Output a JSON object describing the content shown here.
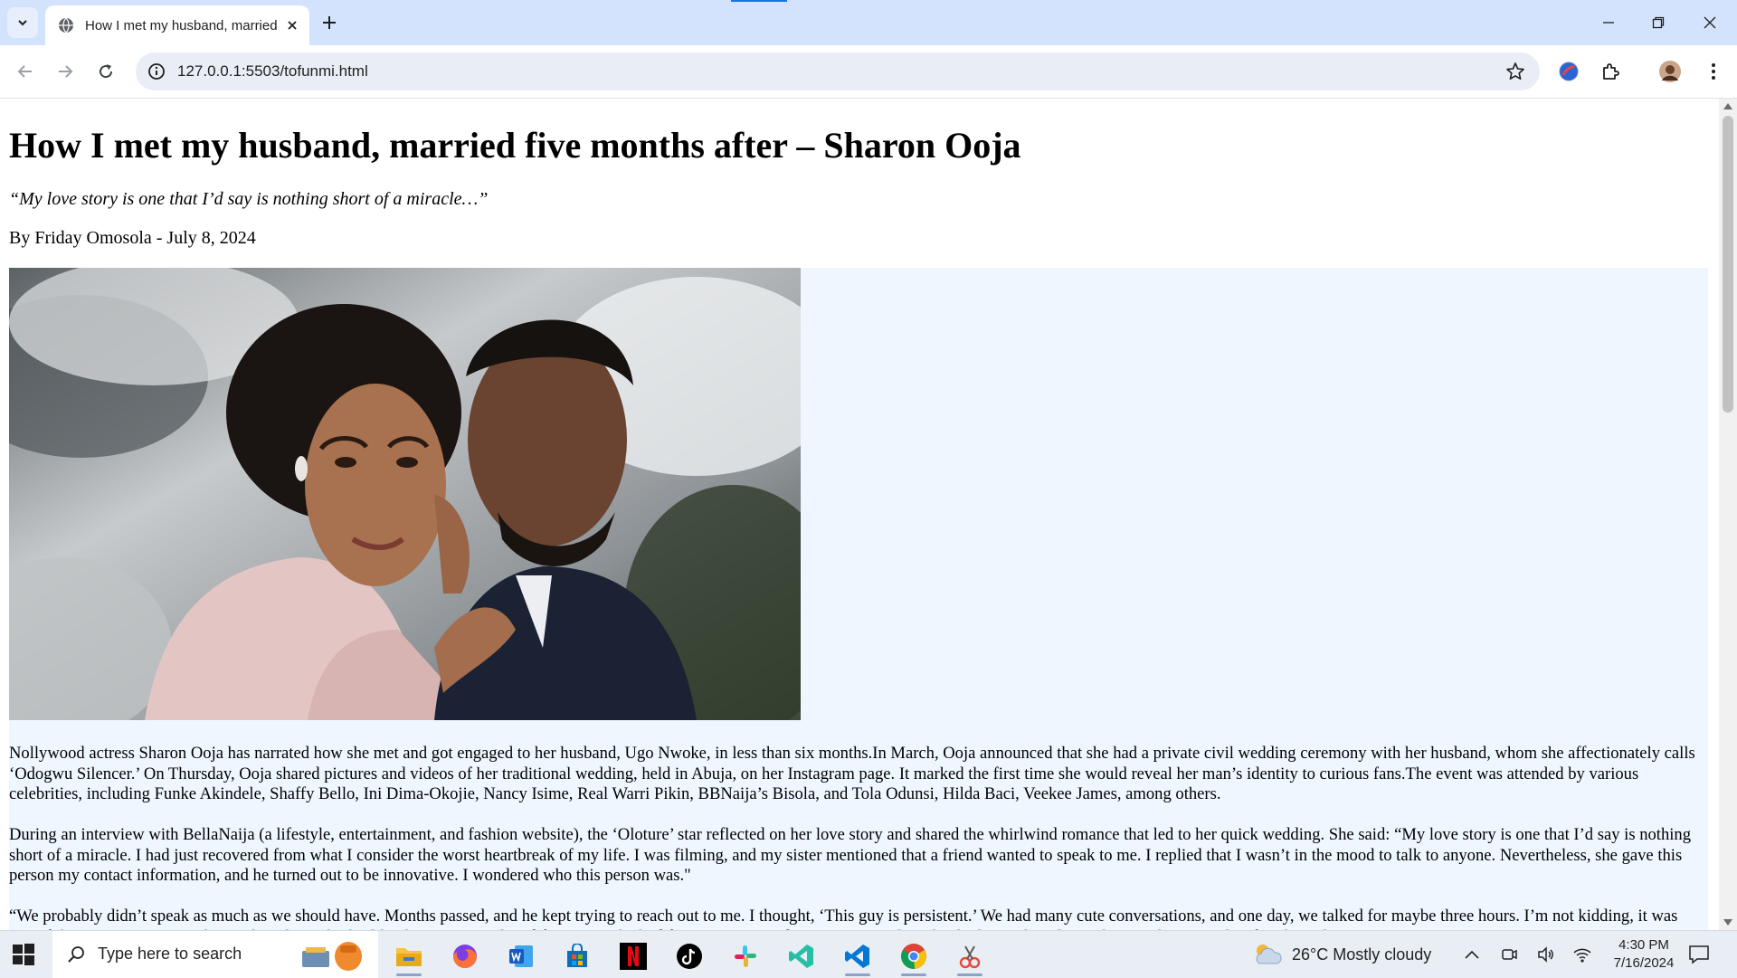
{
  "browser": {
    "tab": {
      "title": "How I met my husband, married five months after – Sharon Ooja"
    },
    "url": "127.0.0.1:5503/tofunmi.html"
  },
  "article": {
    "headline": "How I met my husband, married five months after – Sharon Ooja",
    "subtitle": "“My love story is one that I’d say is nothing short of a miracle…”",
    "byline": "By Friday Omosola - July 8, 2024",
    "paragraphs": [
      "Nollywood actress Sharon Ooja has narrated how she met and got engaged to her husband, Ugo Nwoke, in less than six months.In March, Ooja announced that she had a private civil wedding ceremony with her husband, whom she affectionately calls ‘Odogwu Silencer.’ On Thursday, Ooja shared pictures and videos of her traditional wedding, held in Abuja, on her Instagram page. It marked the first time she would reveal her man’s identity to curious fans.The event was attended by various celebrities, including Funke Akindele, Shaffy Bello, Ini Dima-Okojie, Nancy Isime, Real Warri Pikin, BBNaija’s Bisola, and Tola Odunsi, Hilda Baci, Veekee James, among others.",
      "During an interview with BellaNaija (a lifestyle, entertainment, and fashion website), the ‘Oloture’ star reflected on her love story and shared the whirlwind romance that led to her quick wedding. She said: “My love story is one that I’d say is nothing short of a miracle. I had just recovered from what I consider the worst heartbreak of my life. I was filming, and my sister mentioned that a friend wanted to speak to me. I replied that I wasn’t in the mood to talk to anyone. Nevertheless, she gave this person my contact information, and he turned out to be innovative. I wondered who this person was.\"",
      "“We probably didn’t speak as much as we should have. Months passed, and he kept trying to reach out to me. I thought, ‘This guy is persistent.’ We had many cute conversations, and one day, we talked for maybe three hours. I’m not kidding, it was one of those conversations where I thought, ‘I think I like this guy.’ We played fun games, he had fun questions, and I was very much in the thick. . . . the relationship . . . three months after that, I knew it.”"
    ]
  },
  "taskbar": {
    "search_placeholder": "Type here to search",
    "weather": "26°C  Mostly cloudy",
    "time": "4:30 PM",
    "date": "7/16/2024"
  }
}
